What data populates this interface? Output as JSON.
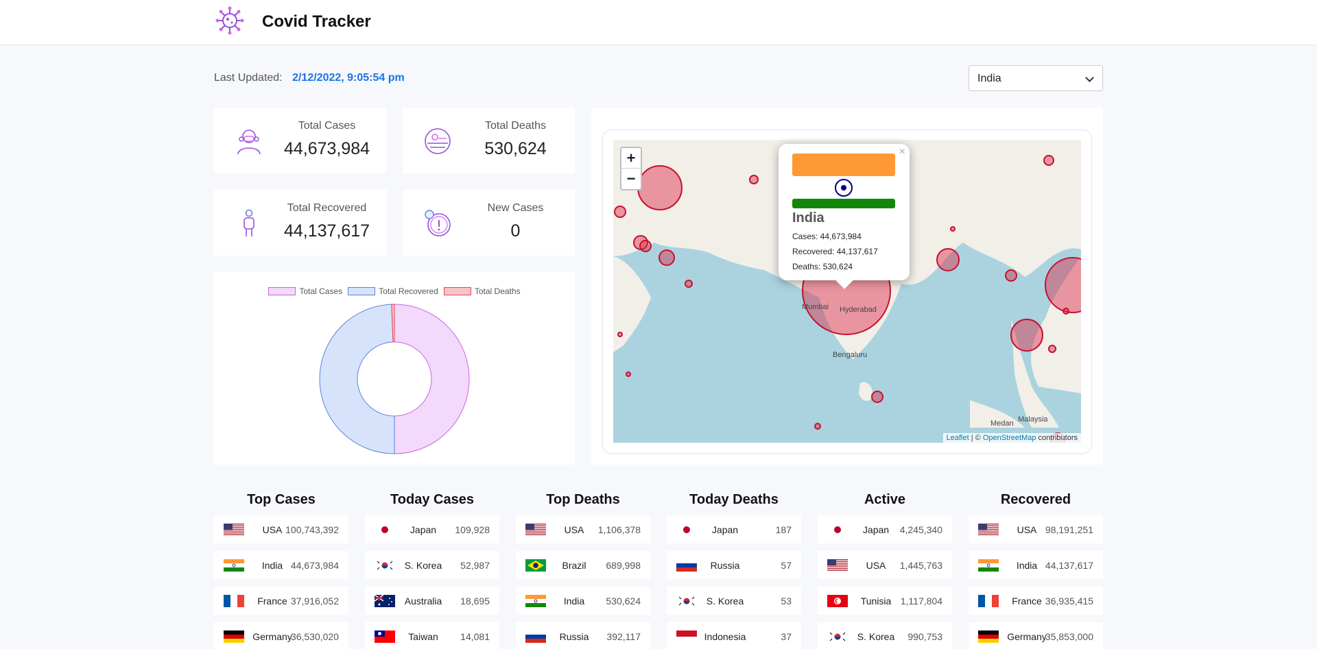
{
  "header": {
    "title": "Covid Tracker",
    "logo_icon": "virus-icon"
  },
  "last_updated": {
    "label": "Last Updated:",
    "value": "2/12/2022, 9:05:54 pm"
  },
  "country_select": {
    "selected": "India"
  },
  "stats": {
    "total_cases": {
      "label": "Total Cases",
      "value": "44,673,984",
      "icon": "patient-masked-icon"
    },
    "total_deaths": {
      "label": "Total Deaths",
      "value": "530,624",
      "icon": "globe-deaths-icon"
    },
    "total_recovered": {
      "label": "Total Recovered",
      "value": "44,137,617",
      "icon": "person-recovered-icon"
    },
    "new_cases": {
      "label": "New Cases",
      "value": "0",
      "icon": "alert-search-icon"
    }
  },
  "chart_data": {
    "type": "pie",
    "categories": [
      "Total Cases",
      "Total Recovered",
      "Total Deaths"
    ],
    "values": [
      44673984,
      44137617,
      530624
    ],
    "colors": [
      "#f3d9fb",
      "#d6e3fb",
      "#f7c4c8"
    ],
    "border_colors": [
      "#c963e0",
      "#5b82dd",
      "#e0475a"
    ],
    "legend_position": "top"
  },
  "map": {
    "zoom_in": "+",
    "zoom_out": "−",
    "attribution": {
      "leaflet": "Leaflet",
      "sep": " | © ",
      "osm": "OpenStreetMap",
      "suffix": " contributors"
    },
    "labels": {
      "mumbai": "Mumbai",
      "hyderabad": "Hyderabad",
      "bengaluru": "Bengaluru",
      "medan": "Medan",
      "malaysia": "Malaysia"
    },
    "popup": {
      "country": "India",
      "cases": "Cases: 44,673,984",
      "recovered": "Recovered: 44,137,617",
      "deaths": "Deaths: 530,624",
      "close": "×"
    }
  },
  "lists": [
    {
      "title": "Top Cases",
      "rows": [
        {
          "flag": "us",
          "country": "USA",
          "value": "100,743,392"
        },
        {
          "flag": "in",
          "country": "India",
          "value": "44,673,984"
        },
        {
          "flag": "fr",
          "country": "France",
          "value": "37,916,052"
        },
        {
          "flag": "de",
          "country": "Germany",
          "value": "36,530,020"
        }
      ]
    },
    {
      "title": "Today Cases",
      "rows": [
        {
          "flag": "jp",
          "country": "Japan",
          "value": "109,928"
        },
        {
          "flag": "kr",
          "country": "S. Korea",
          "value": "52,987"
        },
        {
          "flag": "au",
          "country": "Australia",
          "value": "18,695"
        },
        {
          "flag": "tw",
          "country": "Taiwan",
          "value": "14,081"
        }
      ]
    },
    {
      "title": "Top Deaths",
      "rows": [
        {
          "flag": "us",
          "country": "USA",
          "value": "1,106,378"
        },
        {
          "flag": "br",
          "country": "Brazil",
          "value": "689,998"
        },
        {
          "flag": "in",
          "country": "India",
          "value": "530,624"
        },
        {
          "flag": "ru",
          "country": "Russia",
          "value": "392,117"
        }
      ]
    },
    {
      "title": "Today Deaths",
      "rows": [
        {
          "flag": "jp",
          "country": "Japan",
          "value": "187"
        },
        {
          "flag": "ru",
          "country": "Russia",
          "value": "57"
        },
        {
          "flag": "kr",
          "country": "S. Korea",
          "value": "53"
        },
        {
          "flag": "id",
          "country": "Indonesia",
          "value": "37"
        }
      ]
    },
    {
      "title": "Active",
      "rows": [
        {
          "flag": "jp",
          "country": "Japan",
          "value": "4,245,340"
        },
        {
          "flag": "us",
          "country": "USA",
          "value": "1,445,763"
        },
        {
          "flag": "tn",
          "country": "Tunisia",
          "value": "1,117,804"
        },
        {
          "flag": "kr",
          "country": "S. Korea",
          "value": "990,753"
        }
      ]
    },
    {
      "title": "Recovered",
      "rows": [
        {
          "flag": "us",
          "country": "USA",
          "value": "98,191,251"
        },
        {
          "flag": "in",
          "country": "India",
          "value": "44,137,617"
        },
        {
          "flag": "fr",
          "country": "France",
          "value": "36,935,415"
        },
        {
          "flag": "de",
          "country": "Germany",
          "value": "35,853,000"
        }
      ]
    }
  ]
}
